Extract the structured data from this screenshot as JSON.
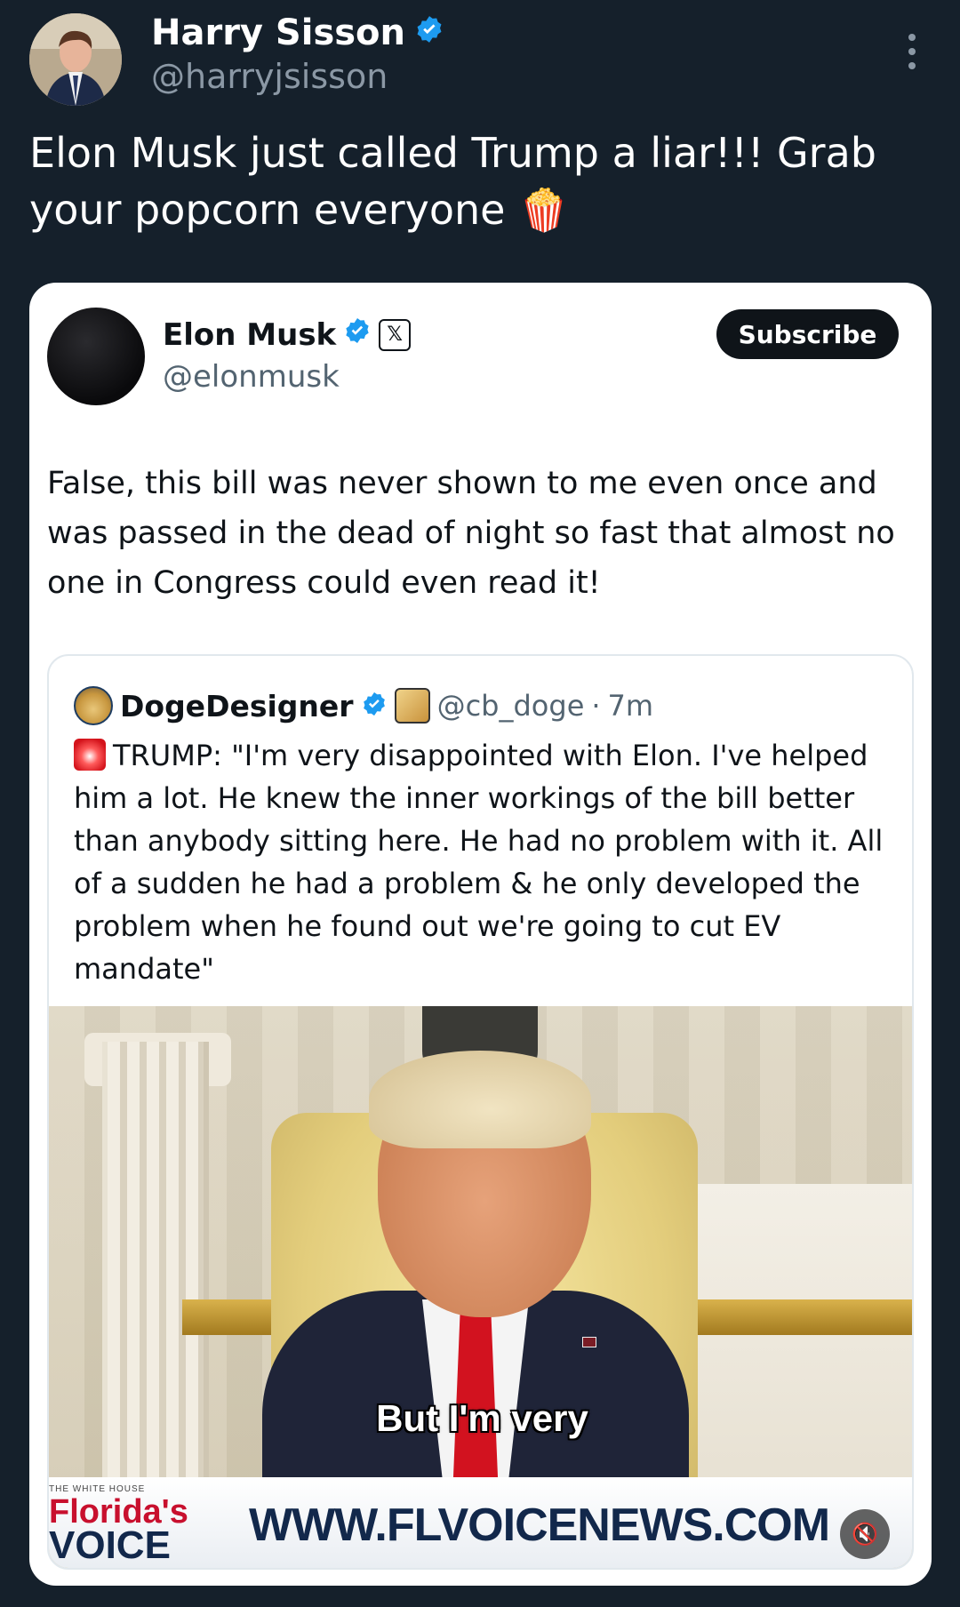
{
  "outer_tweet": {
    "author_name": "Harry Sisson",
    "author_handle": "@harryjsisson",
    "text": "Elon Musk just called Trump a liar!!! Grab your popcorn everyone 🍿"
  },
  "embedded_post": {
    "author_name": "Elon Musk",
    "author_handle": "@elonmusk",
    "affiliation_badge": "𝕏",
    "subscribe_label": "Subscribe",
    "text": "False, this bill was never shown to me even once and was passed in the dead of night so fast that almost no one in Congress could even read it!",
    "quoted": {
      "author_name": "DogeDesigner",
      "author_handle": "@cb_doge",
      "separator": "·",
      "time": "7m",
      "text": "TRUMP: \"I'm very disappointed with Elon. I've helped him a lot. He knew the inner workings of the bill better than anybody sitting here. He had no problem with it. All of a sudden he had a problem & he only developed the problem when he found out we're going to cut EV mandate\"",
      "video": {
        "caption": "But I'm very",
        "banner_small_text": "THE WHITE HOUSE",
        "banner_logo_line1": "Florida's",
        "banner_logo_line2": "VOICE",
        "banner_url": "WWW.FLVOICENEWS.COM",
        "mute_icon": "🔇"
      }
    }
  },
  "colors": {
    "background": "#15202b",
    "verified": "#1d9bf0",
    "subscribe_button": "#0f1419"
  }
}
